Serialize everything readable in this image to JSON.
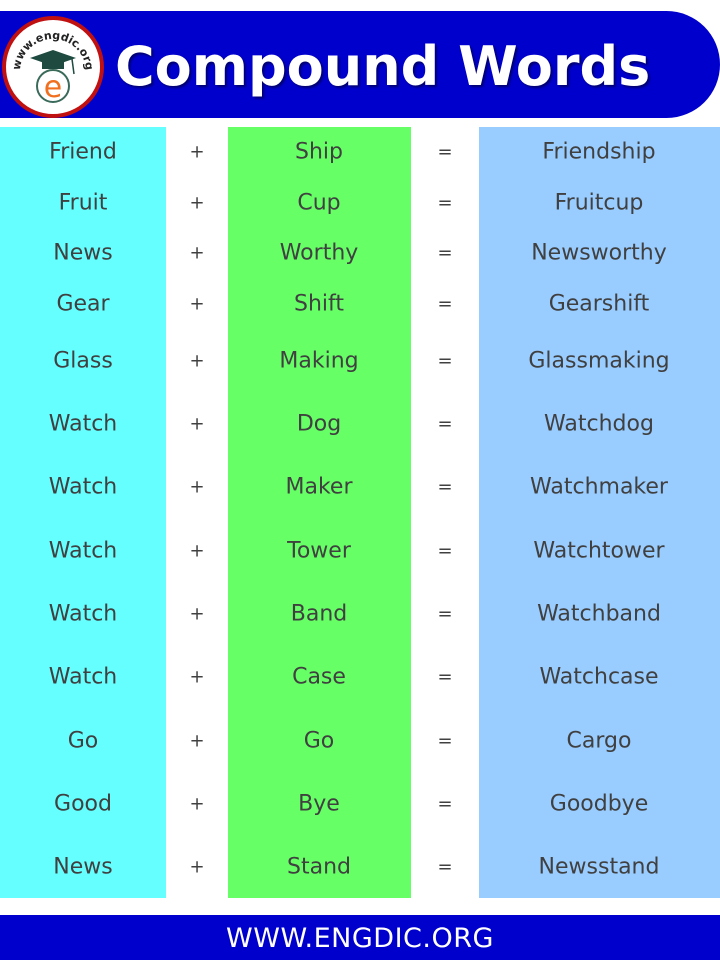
{
  "header": {
    "title": "Compound Words",
    "logo_text": "www.engdic.org",
    "logo_letter": "e"
  },
  "rows": [
    {
      "first": "Friend",
      "plus": "+",
      "second": "Ship",
      "equals": "=",
      "result": "Friendship"
    },
    {
      "first": "Fruit",
      "plus": "+",
      "second": "Cup",
      "equals": "=",
      "result": "Fruitcup"
    },
    {
      "first": "News",
      "plus": "+",
      "second": "Worthy",
      "equals": "=",
      "result": "Newsworthy"
    },
    {
      "first": "Gear",
      "plus": "+",
      "second": "Shift",
      "equals": "=",
      "result": "Gearshift"
    },
    {
      "first": "Glass",
      "plus": "+",
      "second": "Making",
      "equals": "=",
      "result": "Glassmaking"
    },
    {
      "first": "Watch",
      "plus": "+",
      "second": "Dog",
      "equals": "=",
      "result": "Watchdog"
    },
    {
      "first": "Watch",
      "plus": "+",
      "second": "Maker",
      "equals": "=",
      "result": "Watchmaker"
    },
    {
      "first": "Watch",
      "plus": "+",
      "second": "Tower",
      "equals": "=",
      "result": "Watchtower"
    },
    {
      "first": "Watch",
      "plus": "+",
      "second": "Band",
      "equals": "=",
      "result": "Watchband"
    },
    {
      "first": "Watch",
      "plus": "+",
      "second": "Case",
      "equals": "=",
      "result": "Watchcase"
    },
    {
      "first": "Go",
      "plus": "+",
      "second": "Go",
      "equals": "=",
      "result": "Cargo"
    },
    {
      "first": "Good",
      "plus": "+",
      "second": "Bye",
      "equals": "=",
      "result": "Goodbye"
    },
    {
      "first": "News",
      "plus": "+",
      "second": "Stand",
      "equals": "=",
      "result": "Newsstand"
    }
  ],
  "footer": {
    "text": "WWW.ENGDIC.ORG"
  },
  "colors": {
    "brand_blue": "#0000cc",
    "column_first": "#66ffff",
    "column_second": "#66ff66",
    "column_result": "#99ccff",
    "text": "#404040",
    "logo_ring": "#c01010"
  }
}
